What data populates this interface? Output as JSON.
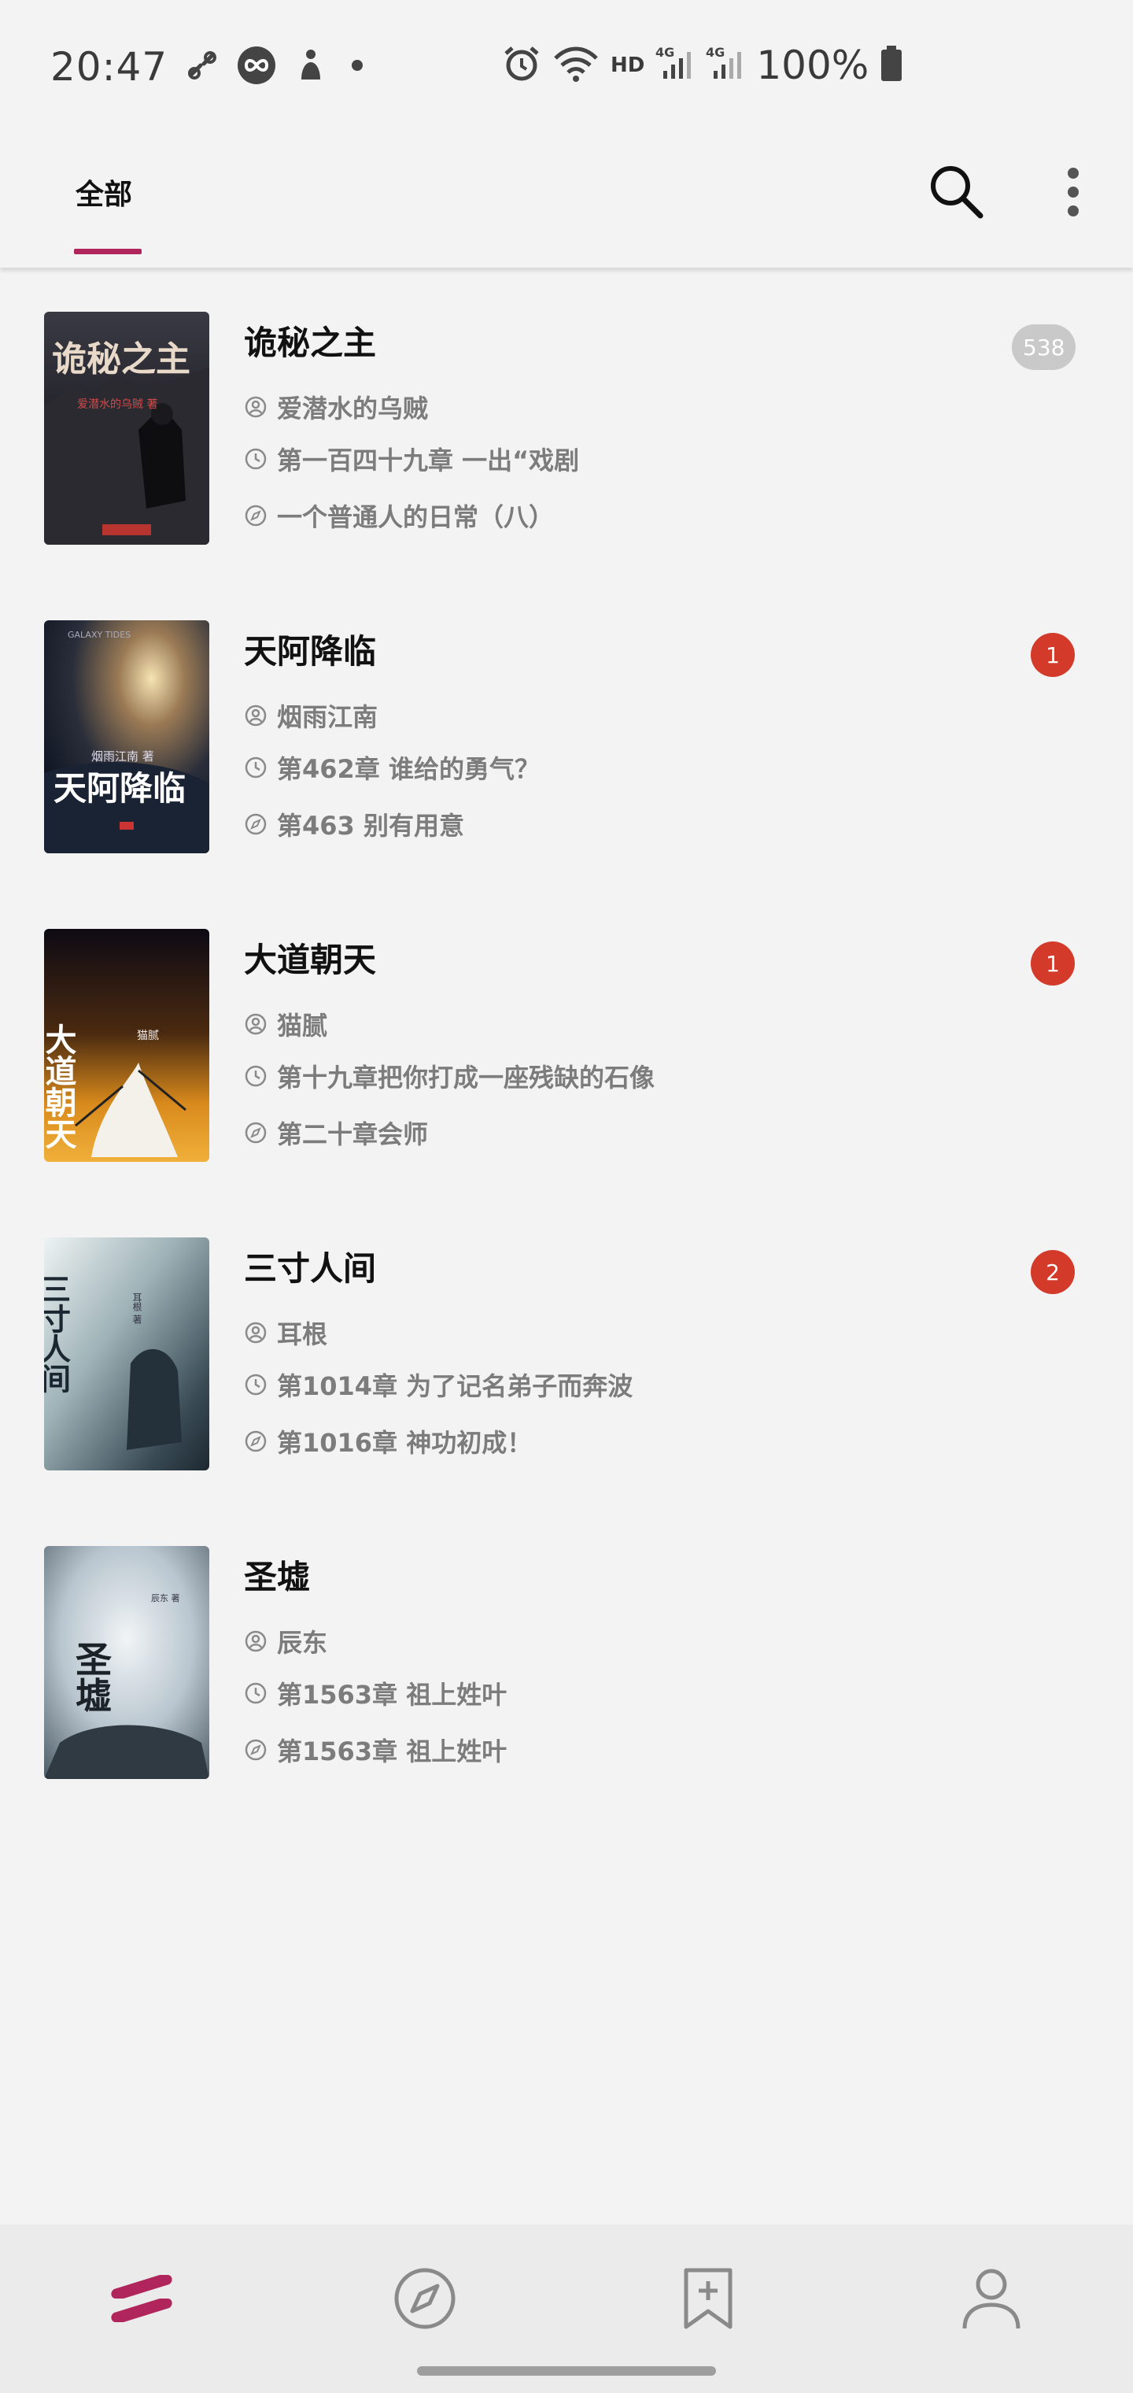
{
  "status_bar": {
    "time": "20:47",
    "network": "HD",
    "battery": "100%",
    "icons": [
      "link-icon",
      "infinity-icon",
      "accessibility-icon",
      "dot-icon",
      "alarm-icon",
      "wifi-icon",
      "signal-4g-icon",
      "signal-4g-icon",
      "battery-icon"
    ]
  },
  "top_bar": {
    "tab_label": "全部",
    "accent": "#b0265c",
    "actions": [
      "search-icon",
      "more-vert-icon"
    ]
  },
  "books": [
    {
      "title": "诡秘之主",
      "author": "爱潜水的乌贼",
      "latest_chapter": "第一百四十九章 一出“戏剧",
      "read_chapter": "一个普通人的日常（八）",
      "badge": "538",
      "badge_type": "count",
      "cover": {
        "text": "诡秘之主",
        "sub": "爱潜水的乌贼 著"
      }
    },
    {
      "title": "天阿降临",
      "author": "烟雨江南",
      "latest_chapter": "第462章 谁给的勇气？",
      "read_chapter": "第463 别有用意",
      "badge": "1",
      "badge_type": "new",
      "cover": {
        "text": "天阿降临",
        "sub": "烟雨江南 著"
      }
    },
    {
      "title": "大道朝天",
      "author": "猫腻",
      "latest_chapter": "第十九章把你打成一座残缺的石像",
      "read_chapter": "第二十章会师",
      "badge": "1",
      "badge_type": "new",
      "cover": {
        "text": "大道朝天",
        "sub": "猫腻"
      }
    },
    {
      "title": "三寸人间",
      "author": "耳根",
      "latest_chapter": "第1014章 为了记名弟子而奔波",
      "read_chapter": "第1016章 神功初成！",
      "badge": "2",
      "badge_type": "new",
      "cover": {
        "text": "三寸人间",
        "sub": "耳根 著"
      }
    },
    {
      "title": "圣墟",
      "author": "辰东",
      "latest_chapter": "第1563章 祖上姓叶",
      "read_chapter": "第1563章 祖上姓叶",
      "badge": "",
      "badge_type": "none",
      "cover": {
        "text": "圣墟",
        "sub": "辰东 著"
      }
    }
  ],
  "bottom_nav": {
    "items": [
      "bookshelf-icon",
      "explore-icon",
      "bookmark-add-icon",
      "profile-icon"
    ],
    "active": "bookshelf-icon"
  }
}
